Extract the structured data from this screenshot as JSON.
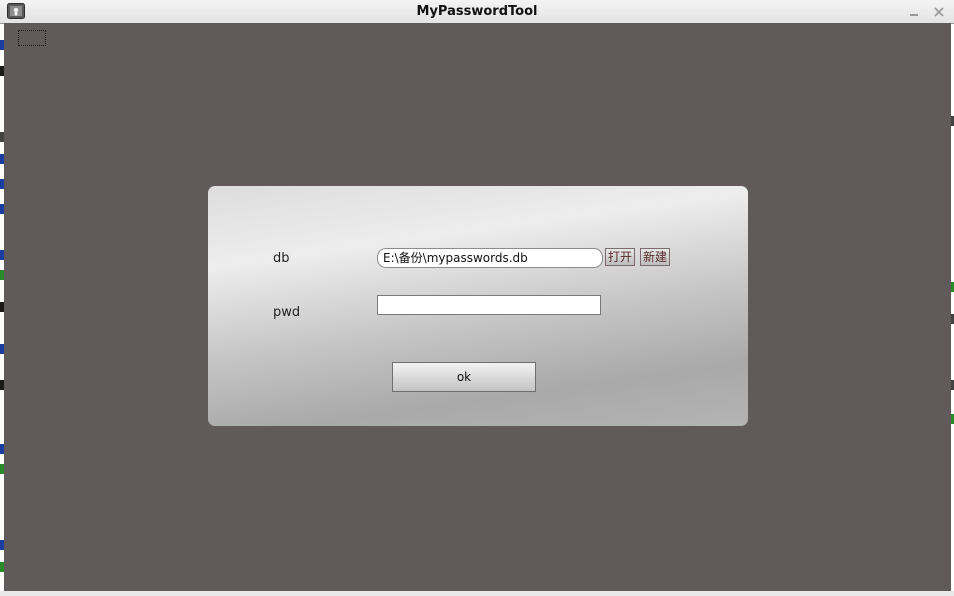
{
  "window": {
    "title": "MyPasswordTool",
    "icons": {
      "app": "app-icon",
      "minimize": "minimize-icon",
      "close": "close-icon"
    }
  },
  "login_dialog": {
    "db_label": "db",
    "db_value": "E:\\备份\\mypasswords.db",
    "open_button_label": "打开",
    "new_button_label": "新建",
    "pwd_label": "pwd",
    "pwd_value": "",
    "ok_button_label": "ok"
  },
  "colors": {
    "client_background": "#605b5a",
    "titlebar": "#e9e9e9",
    "dialog_light": "#ededed",
    "dialog_dark": "#a9a9a9"
  }
}
